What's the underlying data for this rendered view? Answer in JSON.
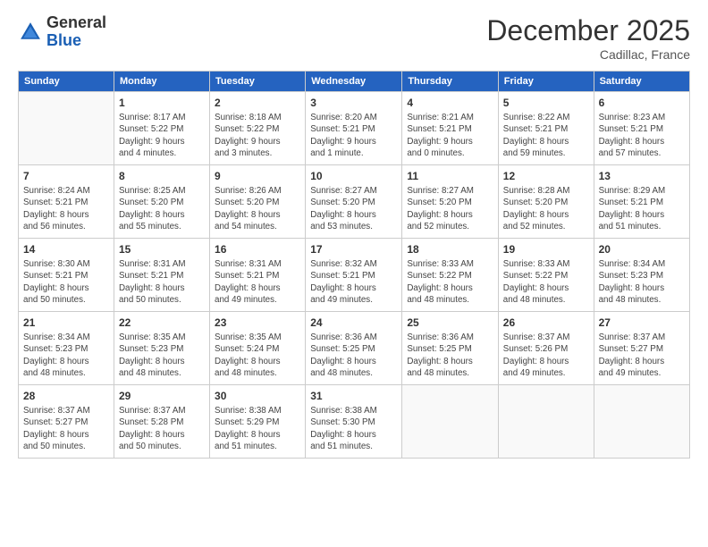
{
  "logo": {
    "general": "General",
    "blue": "Blue"
  },
  "title": "December 2025",
  "location": "Cadillac, France",
  "header_days": [
    "Sunday",
    "Monday",
    "Tuesday",
    "Wednesday",
    "Thursday",
    "Friday",
    "Saturday"
  ],
  "weeks": [
    [
      {
        "day": "",
        "info": ""
      },
      {
        "day": "1",
        "info": "Sunrise: 8:17 AM\nSunset: 5:22 PM\nDaylight: 9 hours\nand 4 minutes."
      },
      {
        "day": "2",
        "info": "Sunrise: 8:18 AM\nSunset: 5:22 PM\nDaylight: 9 hours\nand 3 minutes."
      },
      {
        "day": "3",
        "info": "Sunrise: 8:20 AM\nSunset: 5:21 PM\nDaylight: 9 hours\nand 1 minute."
      },
      {
        "day": "4",
        "info": "Sunrise: 8:21 AM\nSunset: 5:21 PM\nDaylight: 9 hours\nand 0 minutes."
      },
      {
        "day": "5",
        "info": "Sunrise: 8:22 AM\nSunset: 5:21 PM\nDaylight: 8 hours\nand 59 minutes."
      },
      {
        "day": "6",
        "info": "Sunrise: 8:23 AM\nSunset: 5:21 PM\nDaylight: 8 hours\nand 57 minutes."
      }
    ],
    [
      {
        "day": "7",
        "info": "Sunrise: 8:24 AM\nSunset: 5:21 PM\nDaylight: 8 hours\nand 56 minutes."
      },
      {
        "day": "8",
        "info": "Sunrise: 8:25 AM\nSunset: 5:20 PM\nDaylight: 8 hours\nand 55 minutes."
      },
      {
        "day": "9",
        "info": "Sunrise: 8:26 AM\nSunset: 5:20 PM\nDaylight: 8 hours\nand 54 minutes."
      },
      {
        "day": "10",
        "info": "Sunrise: 8:27 AM\nSunset: 5:20 PM\nDaylight: 8 hours\nand 53 minutes."
      },
      {
        "day": "11",
        "info": "Sunrise: 8:27 AM\nSunset: 5:20 PM\nDaylight: 8 hours\nand 52 minutes."
      },
      {
        "day": "12",
        "info": "Sunrise: 8:28 AM\nSunset: 5:20 PM\nDaylight: 8 hours\nand 52 minutes."
      },
      {
        "day": "13",
        "info": "Sunrise: 8:29 AM\nSunset: 5:21 PM\nDaylight: 8 hours\nand 51 minutes."
      }
    ],
    [
      {
        "day": "14",
        "info": "Sunrise: 8:30 AM\nSunset: 5:21 PM\nDaylight: 8 hours\nand 50 minutes."
      },
      {
        "day": "15",
        "info": "Sunrise: 8:31 AM\nSunset: 5:21 PM\nDaylight: 8 hours\nand 50 minutes."
      },
      {
        "day": "16",
        "info": "Sunrise: 8:31 AM\nSunset: 5:21 PM\nDaylight: 8 hours\nand 49 minutes."
      },
      {
        "day": "17",
        "info": "Sunrise: 8:32 AM\nSunset: 5:21 PM\nDaylight: 8 hours\nand 49 minutes."
      },
      {
        "day": "18",
        "info": "Sunrise: 8:33 AM\nSunset: 5:22 PM\nDaylight: 8 hours\nand 48 minutes."
      },
      {
        "day": "19",
        "info": "Sunrise: 8:33 AM\nSunset: 5:22 PM\nDaylight: 8 hours\nand 48 minutes."
      },
      {
        "day": "20",
        "info": "Sunrise: 8:34 AM\nSunset: 5:23 PM\nDaylight: 8 hours\nand 48 minutes."
      }
    ],
    [
      {
        "day": "21",
        "info": "Sunrise: 8:34 AM\nSunset: 5:23 PM\nDaylight: 8 hours\nand 48 minutes."
      },
      {
        "day": "22",
        "info": "Sunrise: 8:35 AM\nSunset: 5:23 PM\nDaylight: 8 hours\nand 48 minutes."
      },
      {
        "day": "23",
        "info": "Sunrise: 8:35 AM\nSunset: 5:24 PM\nDaylight: 8 hours\nand 48 minutes."
      },
      {
        "day": "24",
        "info": "Sunrise: 8:36 AM\nSunset: 5:25 PM\nDaylight: 8 hours\nand 48 minutes."
      },
      {
        "day": "25",
        "info": "Sunrise: 8:36 AM\nSunset: 5:25 PM\nDaylight: 8 hours\nand 48 minutes."
      },
      {
        "day": "26",
        "info": "Sunrise: 8:37 AM\nSunset: 5:26 PM\nDaylight: 8 hours\nand 49 minutes."
      },
      {
        "day": "27",
        "info": "Sunrise: 8:37 AM\nSunset: 5:27 PM\nDaylight: 8 hours\nand 49 minutes."
      }
    ],
    [
      {
        "day": "28",
        "info": "Sunrise: 8:37 AM\nSunset: 5:27 PM\nDaylight: 8 hours\nand 50 minutes."
      },
      {
        "day": "29",
        "info": "Sunrise: 8:37 AM\nSunset: 5:28 PM\nDaylight: 8 hours\nand 50 minutes."
      },
      {
        "day": "30",
        "info": "Sunrise: 8:38 AM\nSunset: 5:29 PM\nDaylight: 8 hours\nand 51 minutes."
      },
      {
        "day": "31",
        "info": "Sunrise: 8:38 AM\nSunset: 5:30 PM\nDaylight: 8 hours\nand 51 minutes."
      },
      {
        "day": "",
        "info": ""
      },
      {
        "day": "",
        "info": ""
      },
      {
        "day": "",
        "info": ""
      }
    ]
  ]
}
